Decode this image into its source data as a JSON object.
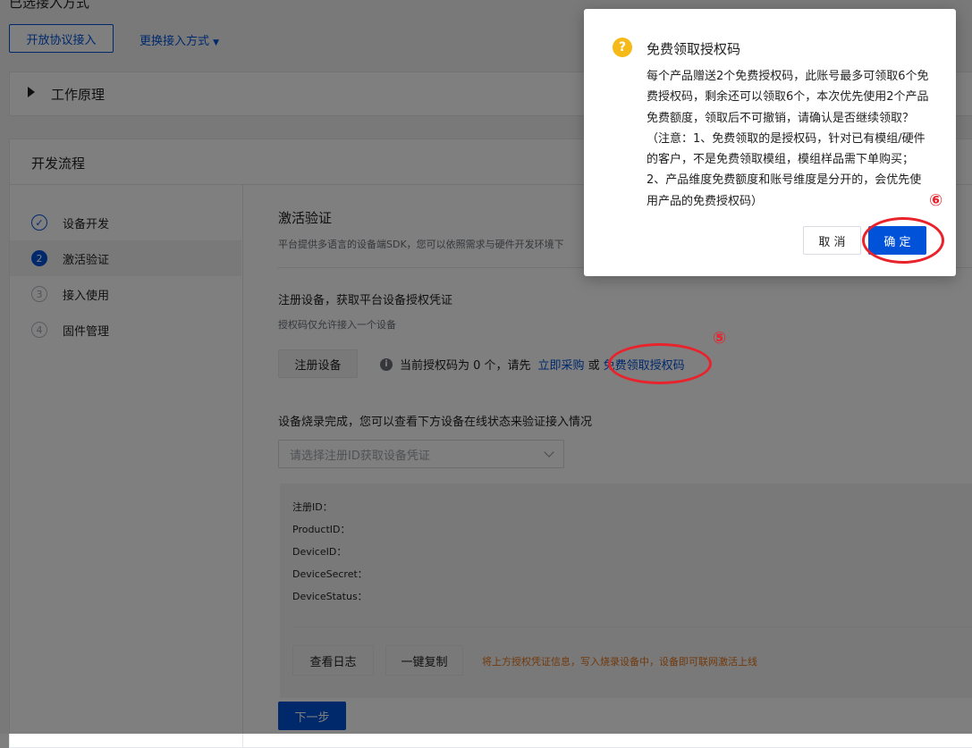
{
  "header": {
    "title": "已选接入方式",
    "open_protocol_button": "开放协议接入",
    "switch_link": "更换接入方式"
  },
  "principle_panel": {
    "title": "工作原理"
  },
  "flow_panel": {
    "title": "开发流程",
    "steps": [
      {
        "index": "✓",
        "label": "设备开发",
        "state": "done"
      },
      {
        "index": "2",
        "label": "激活验证",
        "state": "active"
      },
      {
        "index": "3",
        "label": "接入使用",
        "state": "pending"
      },
      {
        "index": "4",
        "label": "固件管理",
        "state": "pending"
      }
    ]
  },
  "activation": {
    "title": "激活验证",
    "description": "平台提供多语言的设备端SDK，您可以依照需求与硬件开发环境下",
    "register_title": "注册设备，获取平台设备授权凭证",
    "register_desc": "授权码仅允许接入一个设备",
    "register_button": "注册设备",
    "info_prefix": "当前授权码为 0 个，请先",
    "buy_link": "立即采购",
    "or_text": "或",
    "free_link": "免费领取授权码",
    "burn_title": "设备烧录完成，您可以查看下方设备在线状态来验证接入情况",
    "select_placeholder": "请选择注册ID获取设备凭证",
    "credentials": {
      "register_id": "注册ID：",
      "product_id": "ProductID：",
      "device_id": "DeviceID：",
      "device_secret": "DeviceSecret：",
      "device_status": "DeviceStatus："
    },
    "log_button": "查看日志",
    "copy_button": "一键复制",
    "copy_tip": "将上方授权凭证信息，写入烧录设备中，设备即可联网激活上线",
    "next_button": "下一步"
  },
  "dialog": {
    "icon": "question-icon",
    "title": "免费领取授权码",
    "body": "每个产品赠送2个免费授权码，此账号最多可领取6个免费授权码，剩余还可以领取6个，本次优先使用2个产品免费额度，领取后不可撤销，请确认是否继续领取？（注意：1、免费领取的是授权码，针对已有模组/硬件的客户，不是免费领取模组，模组样品需下单购买；2、产品维度免费额度和账号维度是分开的，会优先使用产品的免费授权码）",
    "cancel_button": "取 消",
    "confirm_button": "确 定"
  },
  "annotations": {
    "step5": "⑤",
    "step6": "⑥"
  },
  "colors": {
    "primary": "#0052d9",
    "annotation": "#e8232b",
    "warning": "#e37318",
    "question": "#f5ba18"
  }
}
